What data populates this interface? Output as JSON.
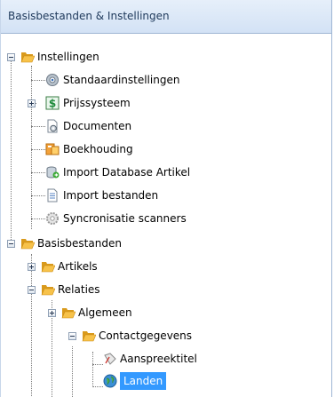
{
  "header": {
    "title": "Basisbestanden & Instellingen"
  },
  "tree": {
    "instellingen": {
      "label": "Instellingen",
      "children": {
        "standaard": "Standaardinstellingen",
        "prijs": "Prijssysteem",
        "documenten": "Documenten",
        "boekhouding": "Boekhouding",
        "import_db": "Import Database Artikel",
        "import_best": "Import bestanden",
        "sync": "Syncronisatie scanners"
      }
    },
    "basisbestanden": {
      "label": "Basisbestanden",
      "artikels": "Artikels",
      "relaties": {
        "label": "Relaties",
        "algemeen": "Algemeen",
        "contactgegevens": {
          "label": "Contactgegevens",
          "aanspreektitel": "Aanspreektitel",
          "landen": "Landen"
        }
      }
    }
  },
  "colors": {
    "selection": "#3399ff",
    "header_text": "#1e395b",
    "folder": "#f2b12f"
  }
}
